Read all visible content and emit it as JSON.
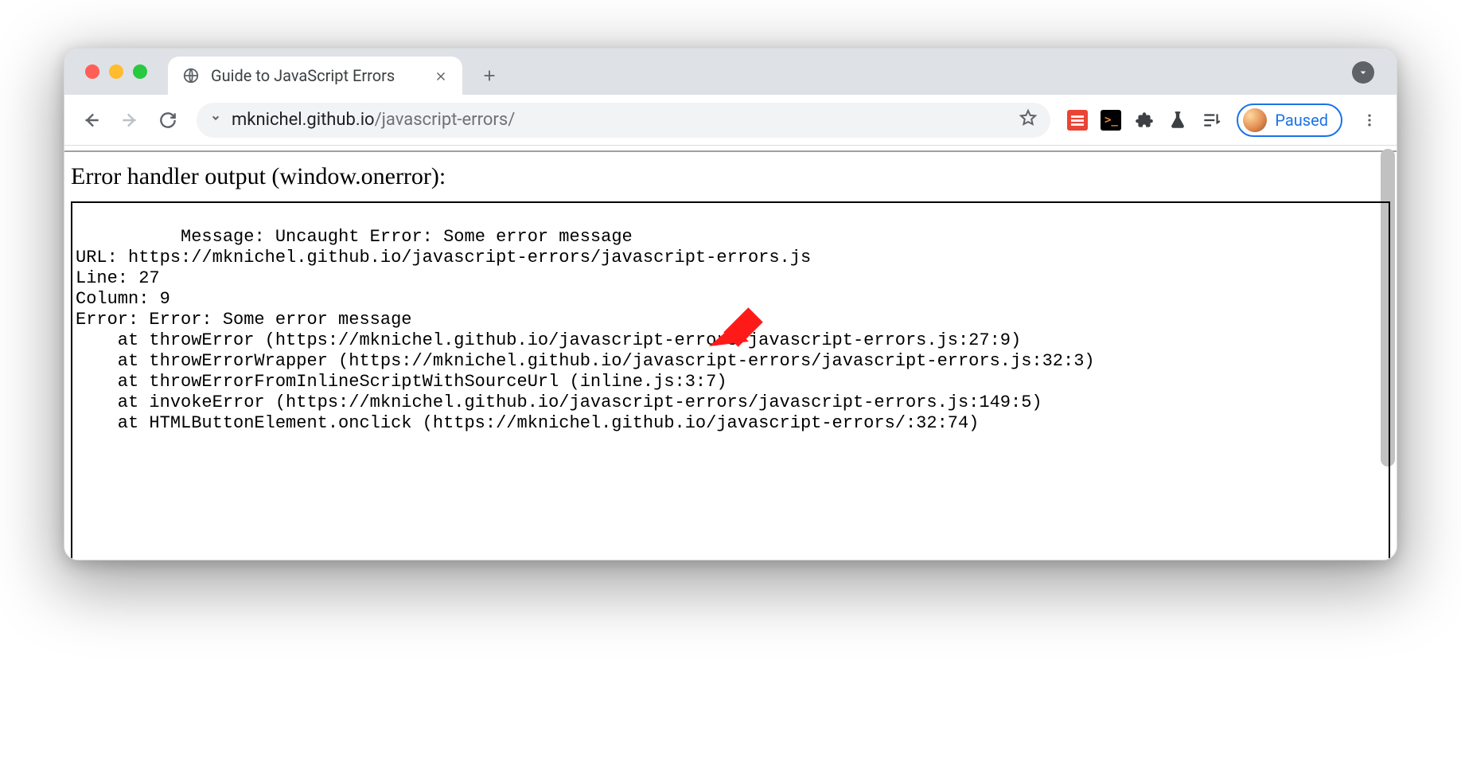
{
  "browser": {
    "tab_title": "Guide to JavaScript Errors",
    "url_host": "mknichel.github.io",
    "url_path": "/javascript-errors/",
    "profile_status": "Paused"
  },
  "page": {
    "heading": "Error handler output (window.onerror):",
    "output": "Message: Uncaught Error: Some error message\nURL: https://mknichel.github.io/javascript-errors/javascript-errors.js\nLine: 27\nColumn: 9\nError: Error: Some error message\n    at throwError (https://mknichel.github.io/javascript-errors/javascript-errors.js:27:9)\n    at throwErrorWrapper (https://mknichel.github.io/javascript-errors/javascript-errors.js:32:3)\n    at throwErrorFromInlineScriptWithSourceUrl (inline.js:3:7)\n    at invokeError (https://mknichel.github.io/javascript-errors/javascript-errors.js:149:5)\n    at HTMLButtonElement.onclick (https://mknichel.github.io/javascript-errors/:32:74)"
  }
}
